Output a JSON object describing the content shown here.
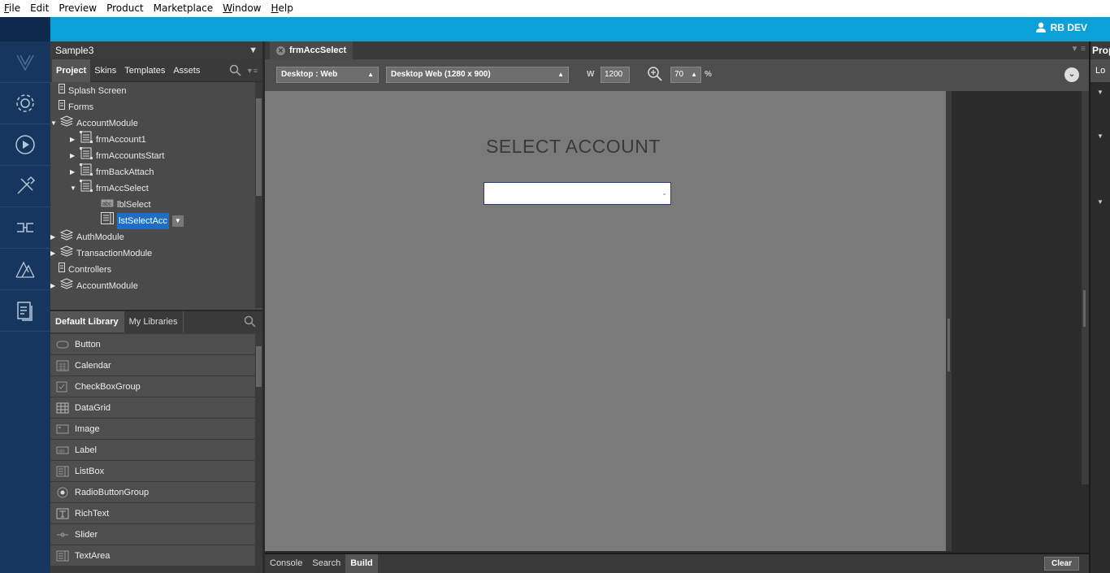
{
  "menu": [
    "File",
    "Edit",
    "Preview",
    "Product",
    "Marketplace",
    "Window",
    "Help"
  ],
  "user": {
    "name": "RB DEV"
  },
  "rail_icons": [
    "visualizer-logo-icon",
    "settings-gear-icon",
    "play-icon",
    "build-tools-icon",
    "services-icon",
    "design-icon",
    "document-icon"
  ],
  "project": {
    "title": "Sample3",
    "tabs": [
      "Project",
      "Skins",
      "Templates",
      "Assets"
    ],
    "tree": [
      {
        "label": "Splash Screen",
        "depth": 0,
        "icon": "page-icon",
        "arrow": ""
      },
      {
        "label": "Forms",
        "depth": 0,
        "icon": "page-icon",
        "arrow": ""
      },
      {
        "label": "AccountModule",
        "depth": 1,
        "icon": "module-icon",
        "arrow": "down"
      },
      {
        "label": "frmAccount1",
        "depth": 2,
        "icon": "form-icon",
        "arrow": "right"
      },
      {
        "label": "frmAccountsStart",
        "depth": 2,
        "icon": "form-icon",
        "arrow": "right"
      },
      {
        "label": "frmBackAttach",
        "depth": 2,
        "icon": "form-icon",
        "arrow": "right"
      },
      {
        "label": "frmAccSelect",
        "depth": 2,
        "icon": "form-icon",
        "arrow": "down"
      },
      {
        "label": "lblSelect",
        "depth": 3,
        "icon": "label-icon",
        "arrow": ""
      },
      {
        "label": "lstSelectAcc",
        "depth": 3,
        "icon": "listbox-icon",
        "arrow": "",
        "selected": true
      },
      {
        "label": "AuthModule",
        "depth": 1,
        "icon": "module-icon",
        "arrow": "right"
      },
      {
        "label": "TransactionModule",
        "depth": 1,
        "icon": "module-icon",
        "arrow": "right"
      },
      {
        "label": "Controllers",
        "depth": 0,
        "icon": "page-icon",
        "arrow": ""
      },
      {
        "label": "AccountModule",
        "depth": 1,
        "icon": "module-icon",
        "arrow": "right"
      }
    ]
  },
  "library": {
    "tabs": [
      "Default Library",
      "My Libraries"
    ],
    "widgets": [
      {
        "label": "Button",
        "icon": "button-icon"
      },
      {
        "label": "Calendar",
        "icon": "calendar-icon"
      },
      {
        "label": "CheckBoxGroup",
        "icon": "checkbox-icon"
      },
      {
        "label": "DataGrid",
        "icon": "datagrid-icon"
      },
      {
        "label": "Image",
        "icon": "image-icon"
      },
      {
        "label": "Label",
        "icon": "label-icon"
      },
      {
        "label": "ListBox",
        "icon": "listbox-icon"
      },
      {
        "label": "RadioButtonGroup",
        "icon": "radio-icon"
      },
      {
        "label": "RichText",
        "icon": "richtext-icon"
      },
      {
        "label": "Slider",
        "icon": "slider-icon"
      },
      {
        "label": "TextArea",
        "icon": "textarea-icon"
      }
    ]
  },
  "editor": {
    "tab": "frmAccSelect",
    "channel": "Desktop : Web",
    "resolution": "Desktop Web (1280 x 900)",
    "width_label": "W",
    "width_value": "1200",
    "zoom_value": "70",
    "zoom_unit": "%",
    "form_title": "SELECT ACCOUNT"
  },
  "bottom": {
    "tabs": [
      "Console",
      "Search",
      "Build"
    ],
    "active": "Build",
    "clear_label": "Clear"
  },
  "properties": {
    "title": "Prop",
    "sub": "Lo"
  }
}
